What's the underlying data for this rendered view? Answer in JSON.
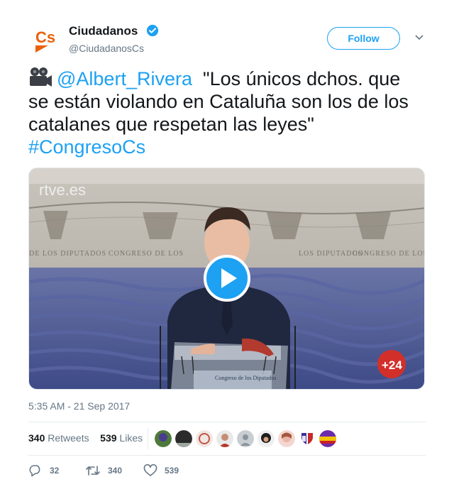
{
  "account": {
    "name": "Ciudadanos",
    "handle": "@CiudadanosCs",
    "logo_text": "Cs",
    "verified": true
  },
  "follow_label": "Follow",
  "tweet": {
    "emoji": "movie-camera",
    "mention": "@Albert_Rivera",
    "quote": "\"Los únicos dchos. que se están violando en Cataluña son los de los catalanes que respetan las leyes\"",
    "hashtag": "#CongresoCs"
  },
  "media": {
    "watermark": "rtve.es",
    "channel_badge": "+24",
    "wall_text_left": "DE LOS DIPUTADOS",
    "wall_text_center": "CONGRESO DE LOS",
    "wall_text_right_1": "LOS DIPUTADOS",
    "wall_text_right_2": "CONGRESO DE LOS",
    "podium_text": "Congreso de los Diputados",
    "play_icon": "play-button-icon"
  },
  "timestamp": "5:35 AM - 21 Sep 2017",
  "stats": {
    "retweets_count": "340",
    "retweets_label": "Retweets",
    "likes_count": "539",
    "likes_label": "Likes"
  },
  "actions": {
    "reply_count": "32",
    "retweet_count": "340",
    "like_count": "539"
  },
  "colors": {
    "link": "#1da1f2",
    "brand_orange": "#eb6109",
    "muted": "#657786"
  }
}
